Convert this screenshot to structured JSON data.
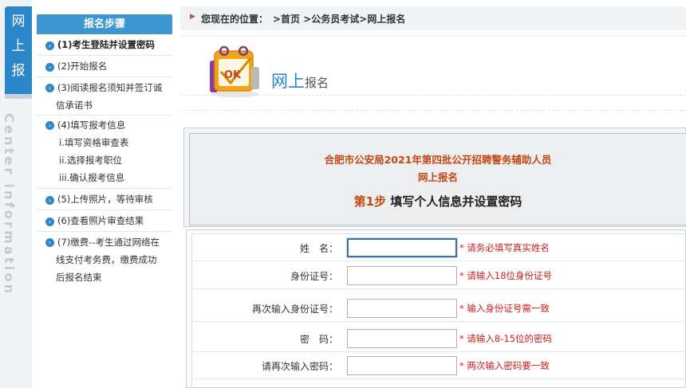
{
  "side_tab": {
    "chars": [
      "网",
      "上",
      "报"
    ],
    "vertical_text": "Center information"
  },
  "steps_panel": {
    "title": "报名步骤",
    "items": [
      {
        "text": "(1)考生登陆并设置密码"
      },
      {
        "text": "(2)开始报名"
      },
      {
        "text": "(3)阅读报名须知并签订诚",
        "text2": "信承诺书"
      },
      {
        "text": "(4)填写报考信息",
        "subs": [
          "i.填写资格审查表",
          "ii.选择报考职位",
          "iii.确认报考信息"
        ]
      },
      {
        "text": "(5)上传照片，等待审核"
      },
      {
        "text": "(6)查看照片审查结果"
      },
      {
        "text": "(7)缴费--考生通过网络在",
        "text2": "线支付考务费，缴费成功",
        "text3": "后报名结束"
      }
    ]
  },
  "breadcrumb": {
    "label": "您现在的位置：",
    "path": ">首页 >公务员考试>网上报名"
  },
  "banner": {
    "title_big": "网上",
    "title_small": "报名",
    "logo_text": "OK"
  },
  "step_block": {
    "org_title": "合肥市公安局2021年第四批公开招聘警务辅助人员",
    "org_sub": "网上报名",
    "step_num": "第1步",
    "step_text": " 填写个人信息并设置密码"
  },
  "form": {
    "fields": [
      {
        "label": "姓　名：",
        "value": "",
        "hint": "* 请务必填写真实姓名"
      },
      {
        "label": "身份证号：",
        "value": "",
        "hint": "* 请输入18位身份证号"
      },
      {
        "label": "再次输入身份证号：",
        "value": "",
        "hint": "* 输入身份证号需一致"
      },
      {
        "label": "密　码：",
        "value": "",
        "hint": "* 请输入8-15位的密码"
      },
      {
        "label": "请再次输入密码：",
        "value": "",
        "hint": "* 两次输入密码要一致"
      }
    ]
  },
  "colors": {
    "accent_blue": "#2a86c8",
    "header_blue": "#3d96cf",
    "title_red": "#c44813",
    "hint_red": "#c81e1e"
  }
}
